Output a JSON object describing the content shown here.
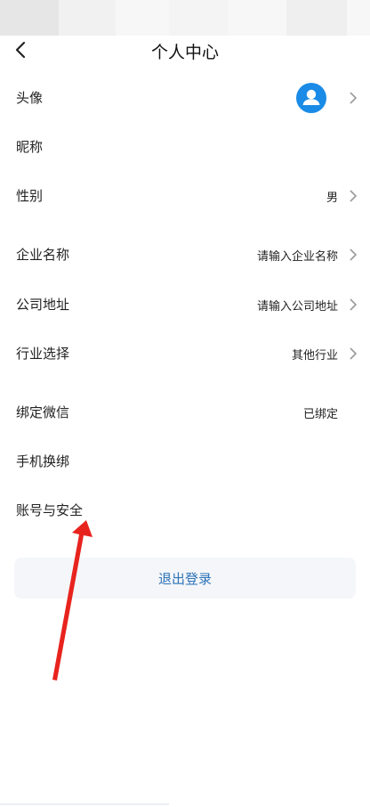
{
  "header": {
    "title": "个人中心"
  },
  "rows": [
    {
      "label": "头像",
      "value": ""
    },
    {
      "label": "昵称",
      "value": ""
    },
    {
      "label": "性别",
      "value": "男"
    },
    {
      "label": "企业名称",
      "value": "请输入企业名称"
    },
    {
      "label": "公司地址",
      "value": "请输入公司地址"
    },
    {
      "label": "行业选择",
      "value": "其他行业"
    },
    {
      "label": "绑定微信",
      "value": "已绑定"
    },
    {
      "label": "手机换绑",
      "value": ""
    },
    {
      "label": "账号与安全",
      "value": ""
    }
  ],
  "logout_label": "退出登录",
  "colors": {
    "avatar_bg": "#1a8be6",
    "logout_text": "#2d73b8",
    "annotation_arrow": "#e8231e"
  },
  "icons": {
    "back": "back-arrow-icon",
    "chevron": "chevron-right-icon",
    "avatar": "user-avatar-icon"
  }
}
